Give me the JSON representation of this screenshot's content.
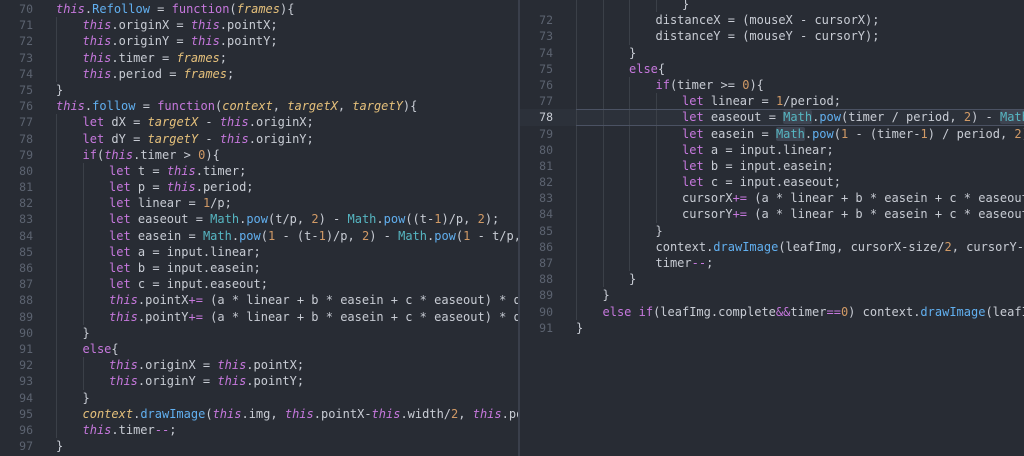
{
  "left_pane": {
    "lines": [
      {
        "n": "70",
        "indent": 1,
        "segs": [
          [
            "th",
            "this"
          ],
          [
            "pl",
            "."
          ],
          [
            "fn",
            "Refollow"
          ],
          [
            "pl",
            " = "
          ],
          [
            "kw",
            "function"
          ],
          [
            "pl",
            "("
          ],
          [
            "pr",
            "frames"
          ],
          [
            "pl",
            "){"
          ]
        ]
      },
      {
        "n": "71",
        "indent": 2,
        "segs": [
          [
            "th",
            "this"
          ],
          [
            "pl",
            ".originX = "
          ],
          [
            "th",
            "this"
          ],
          [
            "pl",
            ".pointX;"
          ]
        ]
      },
      {
        "n": "72",
        "indent": 2,
        "segs": [
          [
            "th",
            "this"
          ],
          [
            "pl",
            ".originY = "
          ],
          [
            "th",
            "this"
          ],
          [
            "pl",
            ".pointY;"
          ]
        ]
      },
      {
        "n": "73",
        "indent": 2,
        "segs": [
          [
            "th",
            "this"
          ],
          [
            "pl",
            ".timer = "
          ],
          [
            "pr",
            "frames"
          ],
          [
            "pl",
            ";"
          ]
        ]
      },
      {
        "n": "74",
        "indent": 2,
        "segs": [
          [
            "th",
            "this"
          ],
          [
            "pl",
            ".period = "
          ],
          [
            "pr",
            "frames"
          ],
          [
            "pl",
            ";"
          ]
        ]
      },
      {
        "n": "75",
        "indent": 1,
        "segs": [
          [
            "pl",
            "}"
          ]
        ]
      },
      {
        "n": "76",
        "indent": 1,
        "segs": [
          [
            "th",
            "this"
          ],
          [
            "pl",
            "."
          ],
          [
            "fn",
            "follow"
          ],
          [
            "pl",
            " = "
          ],
          [
            "kw",
            "function"
          ],
          [
            "pl",
            "("
          ],
          [
            "pr",
            "context"
          ],
          [
            "pl",
            ", "
          ],
          [
            "pr",
            "targetX"
          ],
          [
            "pl",
            ", "
          ],
          [
            "pr",
            "targetY"
          ],
          [
            "pl",
            "){"
          ]
        ]
      },
      {
        "n": "77",
        "indent": 2,
        "segs": [
          [
            "kw",
            "let"
          ],
          [
            "pl",
            " dX = "
          ],
          [
            "pr",
            "targetX"
          ],
          [
            "pl",
            " - "
          ],
          [
            "th",
            "this"
          ],
          [
            "pl",
            ".originX;"
          ]
        ]
      },
      {
        "n": "78",
        "indent": 2,
        "segs": [
          [
            "kw",
            "let"
          ],
          [
            "pl",
            " dY = "
          ],
          [
            "pr",
            "targetY"
          ],
          [
            "pl",
            " - "
          ],
          [
            "th",
            "this"
          ],
          [
            "pl",
            ".originY;"
          ]
        ]
      },
      {
        "n": "79",
        "indent": 2,
        "segs": [
          [
            "kw",
            "if"
          ],
          [
            "pl",
            "("
          ],
          [
            "th",
            "this"
          ],
          [
            "pl",
            ".timer > "
          ],
          [
            "num",
            "0"
          ],
          [
            "pl",
            "){"
          ]
        ]
      },
      {
        "n": "80",
        "indent": 3,
        "segs": [
          [
            "kw",
            "let"
          ],
          [
            "pl",
            " t = "
          ],
          [
            "th",
            "this"
          ],
          [
            "pl",
            ".timer;"
          ]
        ]
      },
      {
        "n": "81",
        "indent": 3,
        "segs": [
          [
            "kw",
            "let"
          ],
          [
            "pl",
            " p = "
          ],
          [
            "th",
            "this"
          ],
          [
            "pl",
            ".period;"
          ]
        ]
      },
      {
        "n": "82",
        "indent": 3,
        "segs": [
          [
            "kw",
            "let"
          ],
          [
            "pl",
            " linear = "
          ],
          [
            "num",
            "1"
          ],
          [
            "pl",
            "/p;"
          ]
        ]
      },
      {
        "n": "83",
        "indent": 3,
        "segs": [
          [
            "kw",
            "let"
          ],
          [
            "pl",
            " easeout = "
          ],
          [
            "mt",
            "Math"
          ],
          [
            "pl",
            "."
          ],
          [
            "fn",
            "pow"
          ],
          [
            "pl",
            "(t/p, "
          ],
          [
            "num",
            "2"
          ],
          [
            "pl",
            ") - "
          ],
          [
            "mt",
            "Math"
          ],
          [
            "pl",
            "."
          ],
          [
            "fn",
            "pow"
          ],
          [
            "pl",
            "((t-"
          ],
          [
            "num",
            "1"
          ],
          [
            "pl",
            ")/p, "
          ],
          [
            "num",
            "2"
          ],
          [
            "pl",
            ");"
          ]
        ]
      },
      {
        "n": "84",
        "indent": 3,
        "segs": [
          [
            "kw",
            "let"
          ],
          [
            "pl",
            " easein = "
          ],
          [
            "mt",
            "Math"
          ],
          [
            "pl",
            "."
          ],
          [
            "fn",
            "pow"
          ],
          [
            "pl",
            "("
          ],
          [
            "num",
            "1"
          ],
          [
            "pl",
            " - (t-"
          ],
          [
            "num",
            "1"
          ],
          [
            "pl",
            ")/p, "
          ],
          [
            "num",
            "2"
          ],
          [
            "pl",
            ") - "
          ],
          [
            "mt",
            "Math"
          ],
          [
            "pl",
            "."
          ],
          [
            "fn",
            "pow"
          ],
          [
            "pl",
            "("
          ],
          [
            "num",
            "1"
          ],
          [
            "pl",
            " - t/p, "
          ],
          [
            "num",
            "2"
          ]
        ]
      },
      {
        "n": "85",
        "indent": 3,
        "segs": [
          [
            "kw",
            "let"
          ],
          [
            "pl",
            " a = input.linear;"
          ]
        ]
      },
      {
        "n": "86",
        "indent": 3,
        "segs": [
          [
            "kw",
            "let"
          ],
          [
            "pl",
            " b = input.easein;"
          ]
        ]
      },
      {
        "n": "87",
        "indent": 3,
        "segs": [
          [
            "kw",
            "let"
          ],
          [
            "pl",
            " c = input.easeout;"
          ]
        ]
      },
      {
        "n": "88",
        "indent": 3,
        "segs": [
          [
            "th",
            "this"
          ],
          [
            "pl",
            ".pointX"
          ],
          [
            "op",
            "+="
          ],
          [
            "pl",
            " (a * linear + b * easein + c * easeout) * dX;"
          ]
        ]
      },
      {
        "n": "89",
        "indent": 3,
        "segs": [
          [
            "th",
            "this"
          ],
          [
            "pl",
            ".pointY"
          ],
          [
            "op",
            "+="
          ],
          [
            "pl",
            " (a * linear + b * easein + c * easeout) * dY;"
          ]
        ]
      },
      {
        "n": "90",
        "indent": 2,
        "segs": [
          [
            "pl",
            "}"
          ]
        ]
      },
      {
        "n": "91",
        "indent": 2,
        "segs": [
          [
            "kw",
            "else"
          ],
          [
            "pl",
            "{"
          ]
        ]
      },
      {
        "n": "92",
        "indent": 3,
        "segs": [
          [
            "th",
            "this"
          ],
          [
            "pl",
            ".originX = "
          ],
          [
            "th",
            "this"
          ],
          [
            "pl",
            ".pointX;"
          ]
        ]
      },
      {
        "n": "93",
        "indent": 3,
        "segs": [
          [
            "th",
            "this"
          ],
          [
            "pl",
            ".originY = "
          ],
          [
            "th",
            "this"
          ],
          [
            "pl",
            ".pointY;"
          ]
        ]
      },
      {
        "n": "94",
        "indent": 2,
        "segs": [
          [
            "pl",
            "}"
          ]
        ]
      },
      {
        "n": "95",
        "indent": 2,
        "segs": [
          [
            "pr",
            "context"
          ],
          [
            "pl",
            "."
          ],
          [
            "fn",
            "drawImage"
          ],
          [
            "pl",
            "("
          ],
          [
            "th",
            "this"
          ],
          [
            "pl",
            ".img, "
          ],
          [
            "th",
            "this"
          ],
          [
            "pl",
            ".pointX-"
          ],
          [
            "th",
            "this"
          ],
          [
            "pl",
            ".width/"
          ],
          [
            "num",
            "2"
          ],
          [
            "pl",
            ", "
          ],
          [
            "th",
            "this"
          ],
          [
            "pl",
            ".poin"
          ]
        ]
      },
      {
        "n": "96",
        "indent": 2,
        "segs": [
          [
            "th",
            "this"
          ],
          [
            "pl",
            ".timer"
          ],
          [
            "op",
            "--"
          ],
          [
            "pl",
            ";"
          ]
        ]
      },
      {
        "n": "97",
        "indent": 1,
        "segs": [
          [
            "pl",
            "}"
          ]
        ]
      }
    ]
  },
  "right_pane": {
    "lines": [
      {
        "n": "",
        "indent": 5,
        "segs": [
          [
            "pl",
            "}"
          ]
        ]
      },
      {
        "n": "72",
        "indent": 4,
        "segs": [
          [
            "pl",
            "distanceX = (mouseX - cursorX);"
          ]
        ]
      },
      {
        "n": "73",
        "indent": 4,
        "segs": [
          [
            "pl",
            "distanceY = (mouseY - cursorY);"
          ]
        ]
      },
      {
        "n": "74",
        "indent": 3,
        "segs": [
          [
            "pl",
            "}"
          ]
        ]
      },
      {
        "n": "75",
        "indent": 3,
        "segs": [
          [
            "kw",
            "else"
          ],
          [
            "pl",
            "{"
          ]
        ]
      },
      {
        "n": "76",
        "indent": 4,
        "segs": [
          [
            "kw",
            "if"
          ],
          [
            "pl",
            "(timer >= "
          ],
          [
            "num",
            "0"
          ],
          [
            "pl",
            "){"
          ]
        ]
      },
      {
        "n": "77",
        "indent": 5,
        "segs": [
          [
            "kw",
            "let"
          ],
          [
            "pl",
            " linear = "
          ],
          [
            "num",
            "1"
          ],
          [
            "pl",
            "/period;"
          ]
        ]
      },
      {
        "n": "78",
        "indent": 5,
        "active": true,
        "segs": [
          [
            "kw",
            "let"
          ],
          [
            "pl",
            " easeout = "
          ],
          [
            "mth",
            "Math"
          ],
          [
            "pl",
            "."
          ],
          [
            "fn",
            "pow"
          ],
          [
            "pl",
            "(timer / period, "
          ],
          [
            "num",
            "2"
          ],
          [
            "pl",
            ") - "
          ],
          [
            "mth",
            "Math"
          ],
          [
            "pl",
            "."
          ],
          [
            "fn",
            "pow"
          ],
          [
            "pl",
            "("
          ]
        ]
      },
      {
        "n": "79",
        "indent": 5,
        "segs": [
          [
            "kw",
            "let"
          ],
          [
            "pl",
            " easein = "
          ],
          [
            "mth",
            "Math"
          ],
          [
            "pl",
            "."
          ],
          [
            "fn",
            "pow"
          ],
          [
            "pl",
            "("
          ],
          [
            "num",
            "1"
          ],
          [
            "pl",
            " - (timer-"
          ],
          [
            "num",
            "1"
          ],
          [
            "pl",
            ") / period, "
          ],
          [
            "num",
            "2"
          ],
          [
            "pl",
            ") - "
          ],
          [
            "mth",
            "Ma"
          ]
        ]
      },
      {
        "n": "80",
        "indent": 5,
        "segs": [
          [
            "kw",
            "let"
          ],
          [
            "pl",
            " a = input.linear;"
          ]
        ]
      },
      {
        "n": "81",
        "indent": 5,
        "segs": [
          [
            "kw",
            "let"
          ],
          [
            "pl",
            " b = input.easein;"
          ]
        ]
      },
      {
        "n": "82",
        "indent": 5,
        "segs": [
          [
            "kw",
            "let"
          ],
          [
            "pl",
            " c = input.easeout;"
          ]
        ]
      },
      {
        "n": "83",
        "indent": 5,
        "segs": [
          [
            "pl",
            "cursorX"
          ],
          [
            "op",
            "+="
          ],
          [
            "pl",
            " (a * linear + b * easein + c * easeout) * d"
          ]
        ]
      },
      {
        "n": "84",
        "indent": 5,
        "segs": [
          [
            "pl",
            "cursorY"
          ],
          [
            "op",
            "+="
          ],
          [
            "pl",
            " (a * linear + b * easein + c * easeout) * d"
          ]
        ]
      },
      {
        "n": "85",
        "indent": 4,
        "segs": [
          [
            "pl",
            "}"
          ]
        ]
      },
      {
        "n": "86",
        "indent": 4,
        "segs": [
          [
            "pl",
            "context."
          ],
          [
            "fn",
            "drawImage"
          ],
          [
            "pl",
            "(leafImg, cursorX-size/"
          ],
          [
            "num",
            "2"
          ],
          [
            "pl",
            ", cursorY-size/"
          ],
          [
            "num",
            "2"
          ]
        ]
      },
      {
        "n": "87",
        "indent": 4,
        "segs": [
          [
            "pl",
            "timer"
          ],
          [
            "op",
            "--"
          ],
          [
            "pl",
            ";"
          ]
        ]
      },
      {
        "n": "88",
        "indent": 3,
        "segs": [
          [
            "pl",
            "}"
          ]
        ]
      },
      {
        "n": "89",
        "indent": 2,
        "segs": [
          [
            "pl",
            "}"
          ]
        ]
      },
      {
        "n": "90",
        "indent": 2,
        "segs": [
          [
            "kw",
            "else if"
          ],
          [
            "pl",
            "(leafImg.complete"
          ],
          [
            "op",
            "&&"
          ],
          [
            "pl",
            "timer"
          ],
          [
            "op",
            "=="
          ],
          [
            "num",
            "0"
          ],
          [
            "pl",
            ") context."
          ],
          [
            "fn",
            "drawImage"
          ],
          [
            "pl",
            "(leafImg, cu"
          ]
        ]
      },
      {
        "n": "91",
        "indent": 1,
        "segs": [
          [
            "pl",
            "}"
          ]
        ]
      }
    ]
  },
  "theme": {
    "background": "#282c34",
    "keyword": "#c678dd",
    "function": "#61afef",
    "param": "#e5c07b",
    "number": "#d19a66",
    "builtin": "#56b6c2",
    "text": "#c8ccd4",
    "line_number": "#5c6370"
  }
}
